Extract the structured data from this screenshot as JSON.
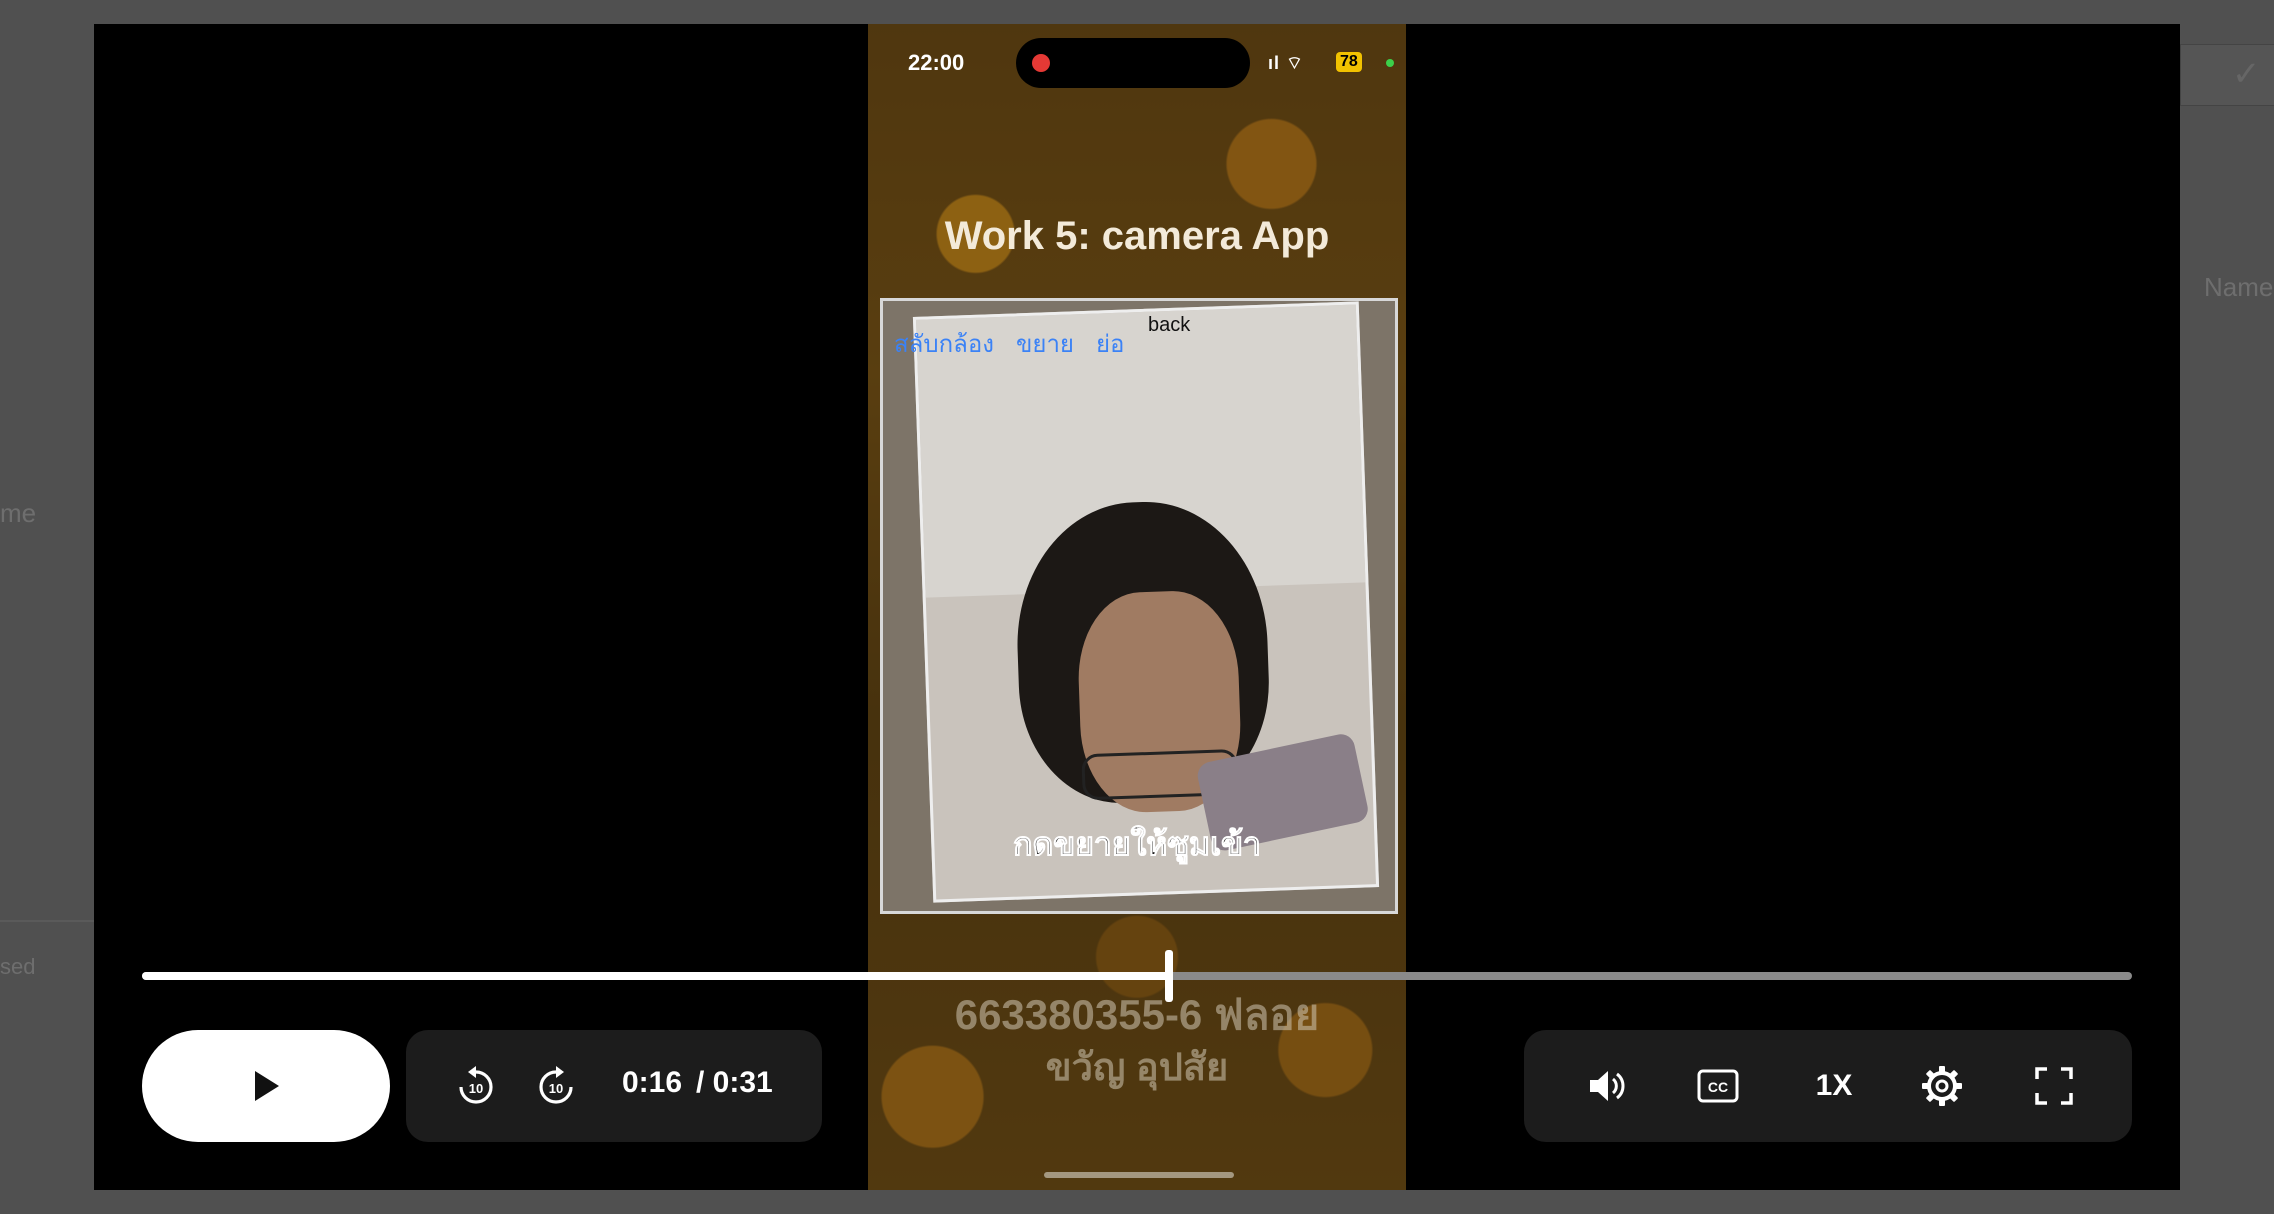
{
  "background_page": {
    "right_label": "Name",
    "left_label": "me",
    "left_bottom_label": "sed"
  },
  "video": {
    "status_time": "22:00",
    "battery": "78",
    "app_title": "Work 5: camera App",
    "camera_links": [
      "สลับกล้อง",
      "ขยาย",
      "ย่อ"
    ],
    "back_label": "back",
    "caption": "กดขยายให้ซูมเข้า",
    "id_line": "663380355-6 ฟลอย",
    "name_line": "ขวัญ อุปสัย"
  },
  "player": {
    "current_time": "0:16",
    "duration": "/ 0:31",
    "progress": 0.516,
    "speed": "1X",
    "icons": {
      "play": "play-icon",
      "rewind": "replay-10-icon",
      "forward": "forward-10-icon",
      "volume": "volume-icon",
      "captions": "closed-captions-icon",
      "settings": "gear-icon",
      "fullscreen": "fullscreen-icon"
    }
  }
}
